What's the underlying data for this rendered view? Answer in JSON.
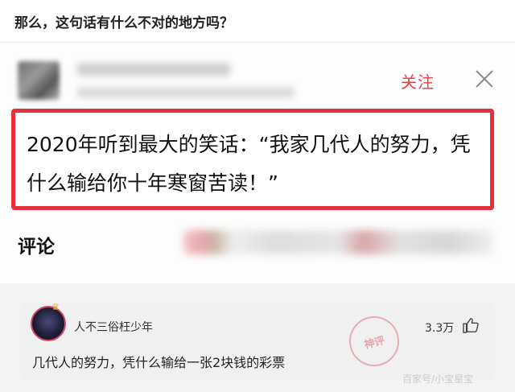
{
  "top_question": "那么，这句话有什么不对的地方吗？",
  "post": {
    "follow_label": "关注",
    "quote_text": "2020年听到最大的笑话：“我家几代人的努力，凭什么输给你十年寒窗苦读！”"
  },
  "comments_section": {
    "label": "评论"
  },
  "comment": {
    "username": "人不三俗枉少年",
    "likes": "3.3万",
    "text": "几代人的努力，凭什么输给一张2块钱的彩票"
  },
  "stamp_text": "神评",
  "watermark_text": "百家号/小宝星宝",
  "colors": {
    "accent_red": "#e8303a",
    "follow_red": "#e8434a"
  }
}
